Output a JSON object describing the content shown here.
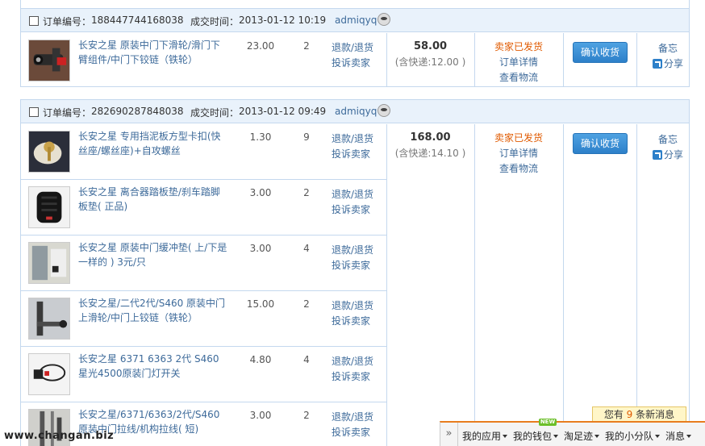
{
  "orders": [
    {
      "order_label": "订单编号：",
      "order_no": "188447744168038",
      "time_label": "成交时间：",
      "time": "2013-01-12 10:19",
      "buyer": "admiqyq",
      "total": "58.00",
      "shipping": "(含快递:12.00 )",
      "status": "卖家已发货",
      "detail_link": "订单详情",
      "logistics_link": "查看物流",
      "confirm_button": "确认收货",
      "memo": "备忘",
      "share": "分享",
      "items": [
        {
          "title": "长安之星 原装中门下滑轮/滑门下臂组件/中门下铰链（铁轮）",
          "price": "23.00",
          "qty": "2",
          "refund": "退款/退货",
          "complain": "投诉卖家"
        }
      ]
    },
    {
      "order_label": "订单编号：",
      "order_no": "282690287848038",
      "time_label": "成交时间：",
      "time": "2013-01-12 09:49",
      "buyer": "admiqyq",
      "total": "168.00",
      "shipping": "(含快递:14.10 )",
      "status": "卖家已发货",
      "detail_link": "订单详情",
      "logistics_link": "查看物流",
      "confirm_button": "确认收货",
      "memo": "备忘",
      "share": "分享",
      "items": [
        {
          "title": "长安之星 专用挡泥板方型卡扣(快丝座/螺丝座)+自攻螺丝",
          "price": "1.30",
          "qty": "9",
          "refund": "退款/退货",
          "complain": "投诉卖家"
        },
        {
          "title": "长安之星 离合器踏板垫/刹车踏脚板垫( 正品)",
          "price": "3.00",
          "qty": "2",
          "refund": "退款/退货",
          "complain": "投诉卖家"
        },
        {
          "title": "长安之星 原装中门缓冲垫( 上/下是一样的 ) 3元/只",
          "price": "3.00",
          "qty": "4",
          "refund": "退款/退货",
          "complain": "投诉卖家"
        },
        {
          "title": "长安之星/二代2代/S460 原装中门上滑轮/中门上铰链（铁轮）",
          "price": "15.00",
          "qty": "2",
          "refund": "退款/退货",
          "complain": "投诉卖家"
        },
        {
          "title": "长安之星 6371 6363 2代 S460 星光4500原装门灯开关",
          "price": "4.80",
          "qty": "4",
          "refund": "退款/退货",
          "complain": "投诉卖家"
        },
        {
          "title": "长安之星/6371/6363/2代/S460原装中门拉线/机构拉线( 短)",
          "price": "3.00",
          "qty": "2",
          "refund": "退款/退货",
          "complain": "投诉卖家"
        }
      ]
    }
  ],
  "watermark": "www.changan.biz",
  "toolbar": {
    "items": [
      "我的应用",
      "我的钱包",
      "淘足迹",
      "我的小分队",
      "消息"
    ],
    "new_badge": "NEW",
    "message_tip_prefix": "您有 ",
    "message_count": "9",
    "message_tip_suffix": " 条新消息"
  },
  "colors": {
    "link": "#3d6a9a",
    "status": "#e05a00",
    "header_bg": "#e9f2fb",
    "border": "#c4d8ee",
    "button": "#2d80c9"
  }
}
